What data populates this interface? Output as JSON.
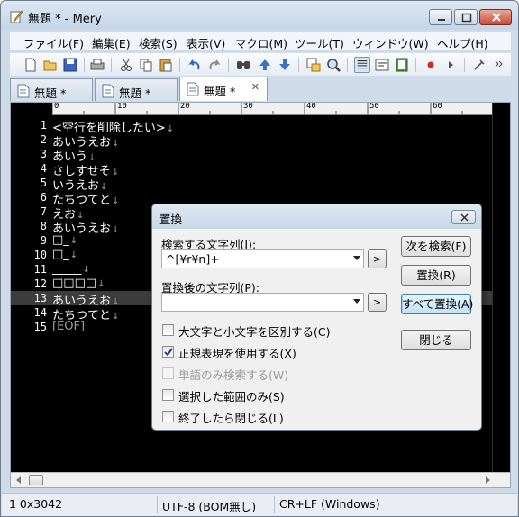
{
  "window": {
    "title": "無題 * - Mery"
  },
  "menu": [
    "ファイル(F)",
    "編集(E)",
    "検索(S)",
    "表示(V)",
    "マクロ(M)",
    "ツール(T)",
    "ウィンドウ(W)",
    "ヘルプ(H)"
  ],
  "tabs": [
    "無題 *",
    "無題 *",
    "無題 *"
  ],
  "ruler": [
    "0",
    "10",
    "20",
    "30",
    "40",
    "50",
    "60"
  ],
  "lines": [
    {
      "num": "1",
      "text": "<空行を削除したい>",
      "mark": "↓"
    },
    {
      "num": "2",
      "text": "あいうえお",
      "mark": "↓"
    },
    {
      "num": "3",
      "text": "あいう",
      "mark": "↓"
    },
    {
      "num": "4",
      "text": "さしすせそ",
      "mark": "↓"
    },
    {
      "num": "5",
      "text": "いうえお",
      "mark": "↓"
    },
    {
      "num": "6",
      "text": "たちつてと",
      "mark": "↓"
    },
    {
      "num": "7",
      "text": "えお",
      "mark": "↓"
    },
    {
      "num": "8",
      "text": "あいうえお",
      "mark": "↓"
    },
    {
      "num": "9",
      "text": "□_",
      "mark": "↓"
    },
    {
      "num": "10",
      "text": "□_",
      "mark": "↓"
    },
    {
      "num": "11",
      "text": "_____",
      "mark": "↓"
    },
    {
      "num": "12",
      "text": "□□□□",
      "mark": "↓"
    },
    {
      "num": "13",
      "text": "あいうえお",
      "mark": "↓"
    },
    {
      "num": "14",
      "text": "たちつてと",
      "mark": "↓"
    },
    {
      "num": "15",
      "text": "[EOF]",
      "mark": ""
    }
  ],
  "dialog": {
    "title": "置換",
    "find_label": "検索する文字列(I):",
    "find_value": "^[¥r¥n]+",
    "replace_label": "置換後の文字列(P):",
    "replace_value": "",
    "small_btn": ">",
    "buttons": {
      "find_next": "次を検索(F)",
      "replace": "置換(R)",
      "replace_all": "すべて置換(A)",
      "close": "閉じる"
    },
    "options": [
      {
        "label": "大文字と小文字を区別する(C)",
        "checked": false,
        "disabled": false
      },
      {
        "label": "正規表現を使用する(X)",
        "checked": true,
        "disabled": false
      },
      {
        "label": "単語のみ検索する(W)",
        "checked": false,
        "disabled": true
      },
      {
        "label": "選択した範囲のみ(S)",
        "checked": false,
        "disabled": false
      },
      {
        "label": "終了したら閉じる(L)",
        "checked": false,
        "disabled": false
      }
    ]
  },
  "status": {
    "position": "1 0x3042",
    "encoding": "UTF-8 (BOM無し)",
    "newline": "CR+LF (Windows)"
  }
}
